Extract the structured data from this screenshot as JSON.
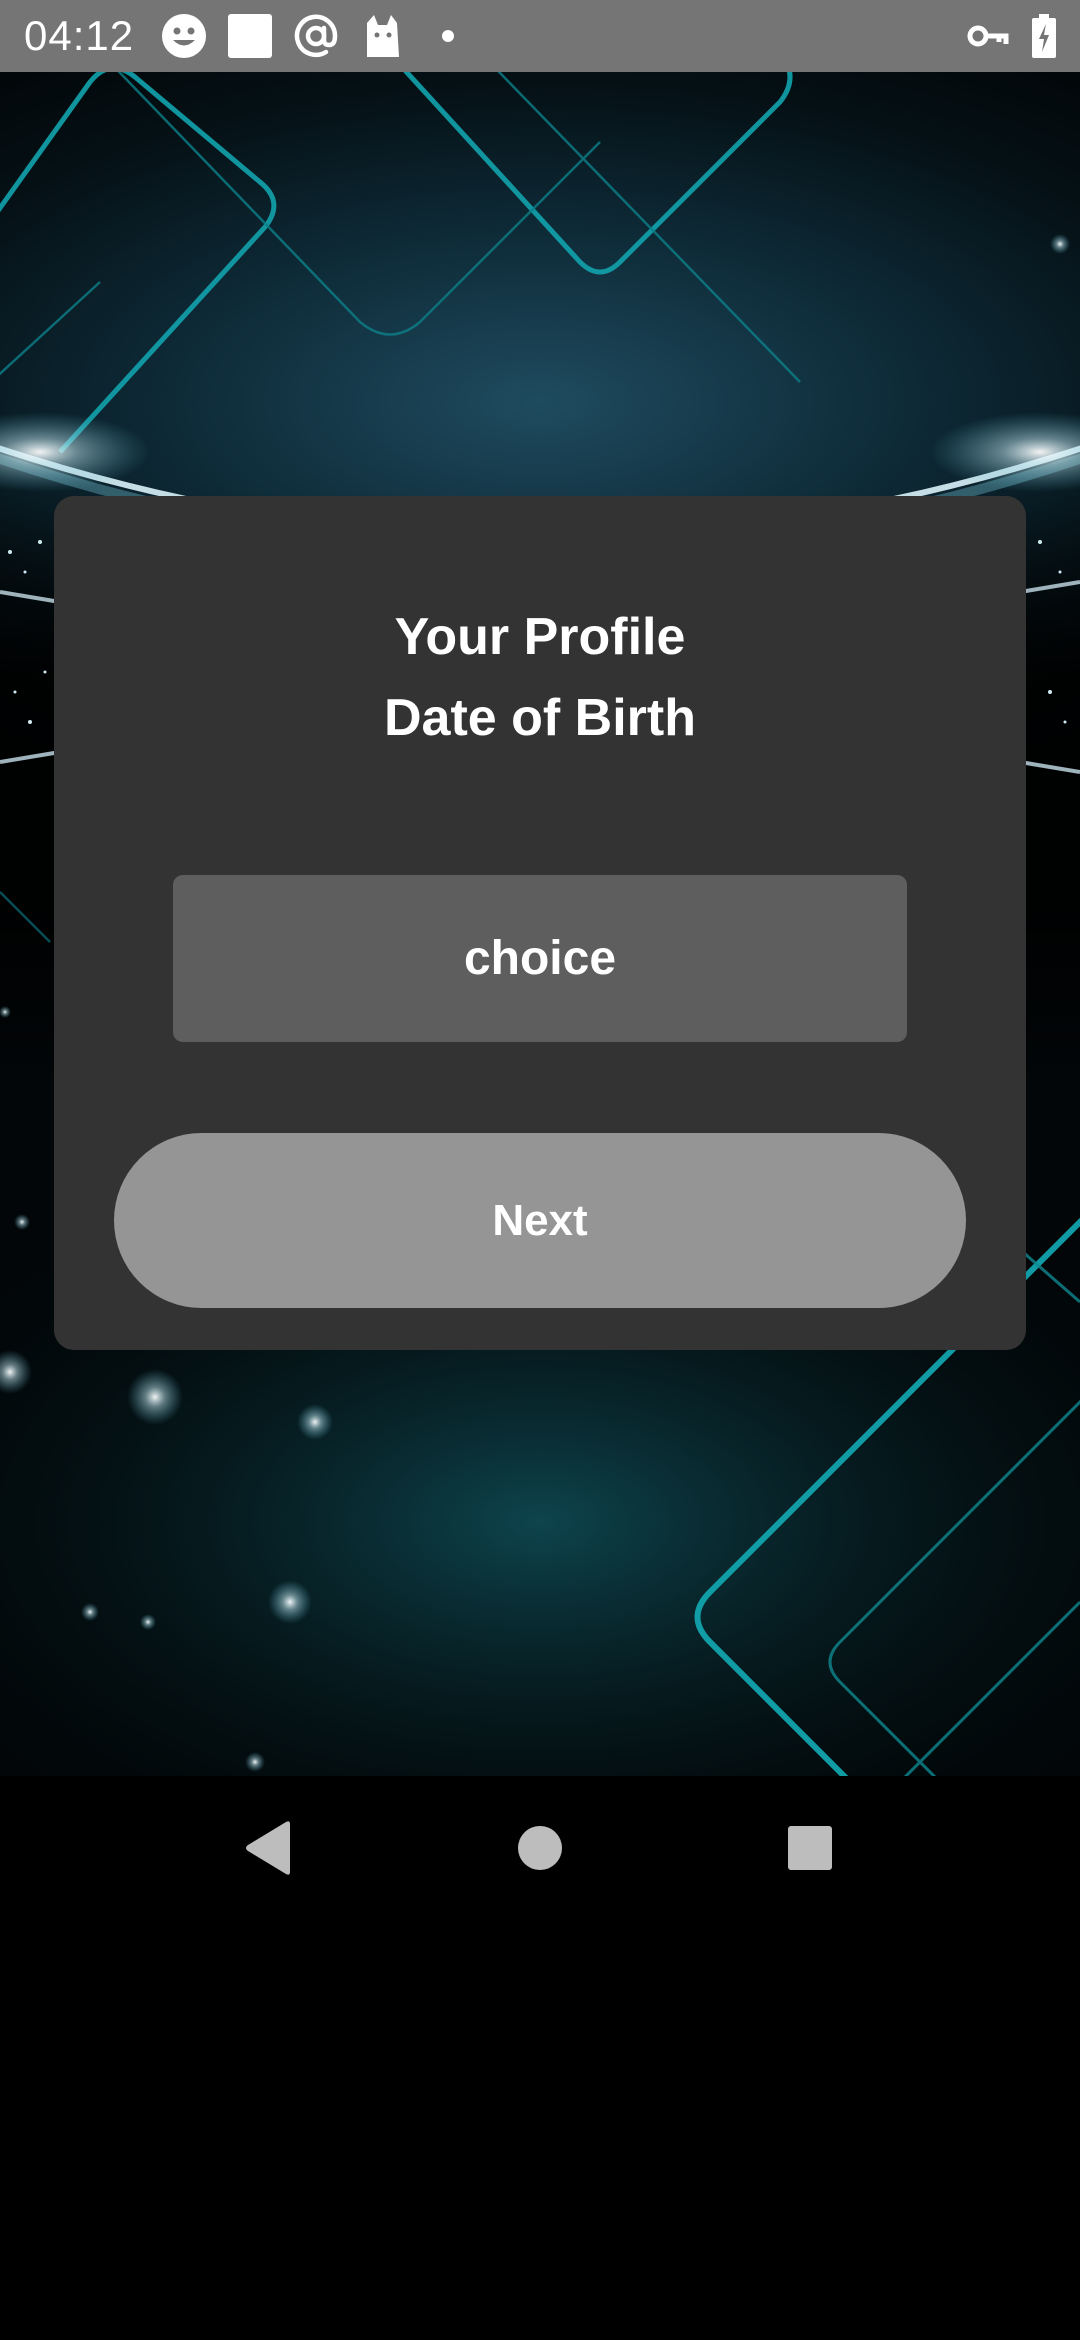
{
  "status_bar": {
    "time": "04:12",
    "left_icons": [
      "smiley-icon",
      "square-notification-icon",
      "at-sign-icon",
      "cat-icon",
      "dot-icon"
    ],
    "right_icons": [
      "vpn-key-icon",
      "battery-charging-icon"
    ]
  },
  "card": {
    "title_line1": "Your Profile",
    "title_line2": "Date of Birth",
    "choice_label": "choice",
    "next_label": "Next"
  },
  "nav_bar": {
    "buttons": [
      "back-icon",
      "home-icon",
      "recents-icon"
    ]
  },
  "colors": {
    "status_bar": "#757575",
    "card": "#333333",
    "choice_box": "#5e5e5e",
    "next_button": "#959595",
    "accent_teal": "#19a6b0"
  }
}
